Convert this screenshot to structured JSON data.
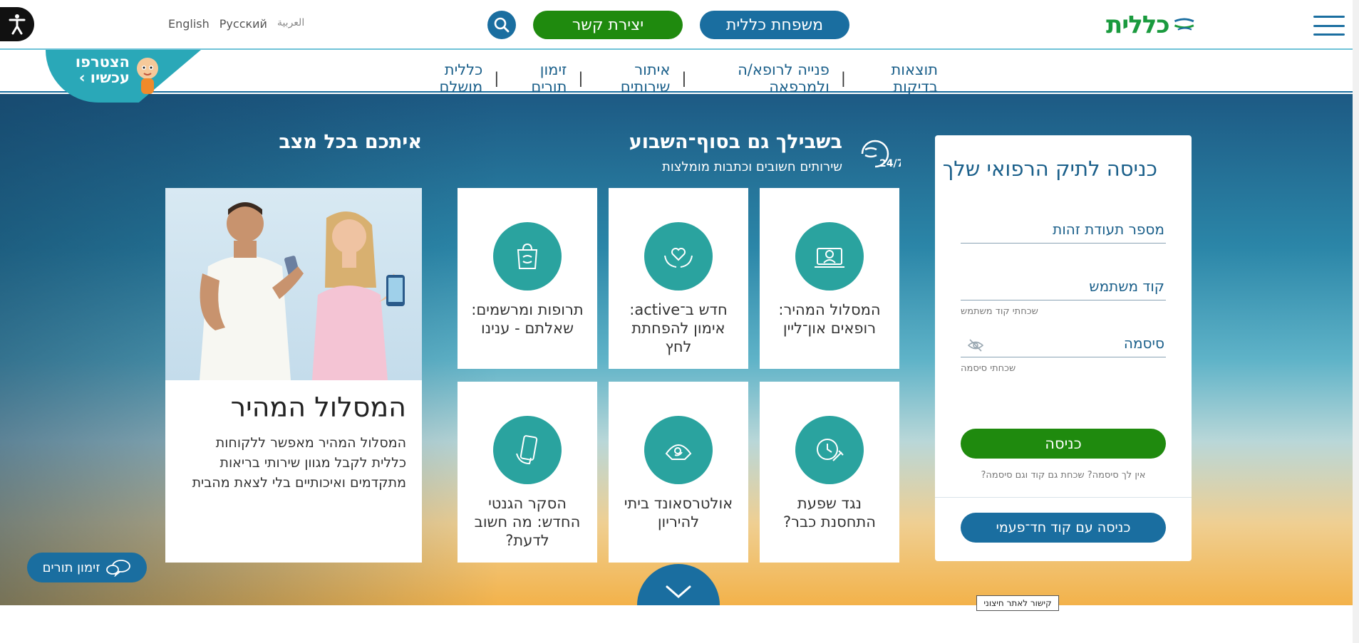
{
  "header": {
    "logo_text": "כללית",
    "family_button": "משפחת כללית",
    "contact_button": "יצירת קשר",
    "languages": [
      "English",
      "Русский",
      "العربية"
    ]
  },
  "nav": {
    "links": [
      "תוצאות בדיקות",
      "פנייה לרופא/ה ולמרפאה",
      "איתור שירותים",
      "זימון תורים",
      "כללית מושלם"
    ]
  },
  "join": {
    "line1": "הצטרפו",
    "line2": "עכשיו ›"
  },
  "login": {
    "title": "כניסה לתיק הרפואי שלך",
    "id_field": "מספר תעודת זהות",
    "user_field": "קוד משתמש",
    "user_hint": "שכחתי קוד משתמש",
    "pass_field": "סיסמה",
    "pass_hint": "שכחתי סיסמה",
    "login_button": "כניסה",
    "no_password": "אין לך סיסמה? שכחת גם קוד וגם סיסמה?",
    "otp_button": "כניסה עם קוד חד־פעמי"
  },
  "weekend": {
    "title": "בשבילך גם בסוף־השבוע",
    "subtitle": "שירותים חשובים וכתבות מומלצות",
    "badge": "24/7",
    "tiles": [
      {
        "label": "המסלול המהיר: רופאים און־ליין",
        "icon": "online-doctor-icon"
      },
      {
        "label": "חדש ב־active: אימון להפחתת לחץ",
        "icon": "heart-hands-icon"
      },
      {
        "label": "תרופות ומרשמים: שאלתם - ענינו",
        "icon": "pharmacy-bag-icon"
      },
      {
        "label": "נגד שפעת התחסנת כבר?",
        "icon": "vaccine-clock-icon"
      },
      {
        "label": "אולטרסאונד ביתי להיריון",
        "icon": "ultrasound-icon"
      },
      {
        "label": "הסקר הגנטי החדש: מה חשוב לדעת?",
        "icon": "phone-hand-icon"
      }
    ]
  },
  "promo": {
    "section_title": "איתכם בכל מצב",
    "heading": "המסלול המהיר",
    "text": "המסלול המהיר מאפשר ללקוחות כללית לקבל מגוון שירותי בריאות מתקדמים ואיכותיים בלי לצאת מהבית"
  },
  "book_button": "זימון תורים",
  "external_tooltip": "קישור לאתר חיצוני",
  "colors": {
    "brand_blue": "#1a6ea0",
    "brand_green": "#1f8a0e",
    "teal": "#2aa39f",
    "logo_green": "#1a9a3e"
  }
}
